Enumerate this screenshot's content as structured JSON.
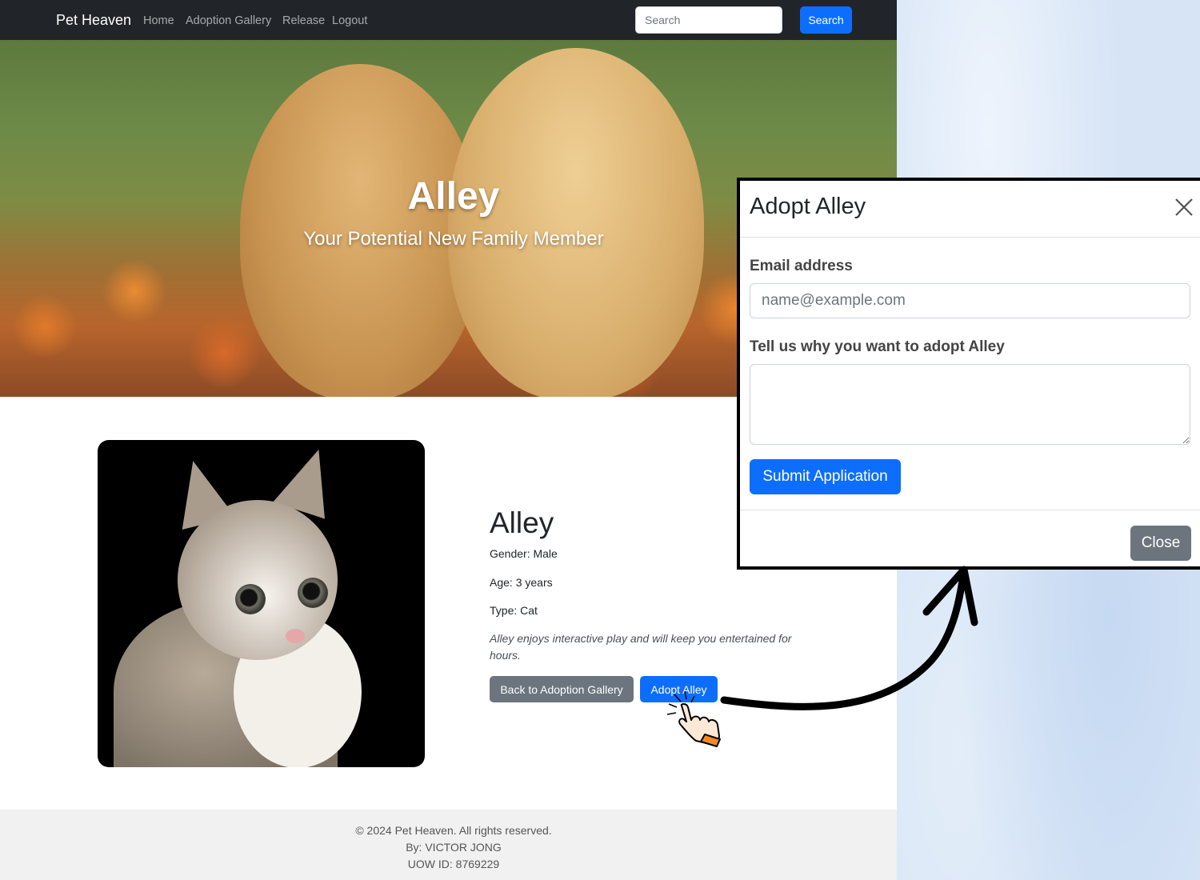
{
  "navbar": {
    "brand": "Pet Heaven",
    "links": [
      "Home",
      "Adoption Gallery",
      "Release",
      "Logout"
    ],
    "search_placeholder": "Search",
    "search_button": "Search"
  },
  "hero": {
    "title": "Alley",
    "subtitle": "Your Potential New Family Member"
  },
  "pet": {
    "name": "Alley",
    "gender": "Gender: Male",
    "age": "Age: 3 years",
    "type": "Type: Cat",
    "description": "Alley enjoys interactive play and will keep you entertained for hours.",
    "back_button": "Back to Adoption Gallery",
    "adopt_button": "Adopt Alley"
  },
  "footer": {
    "copyright": "© 2024 Pet Heaven. All rights reserved.",
    "author": "By: VICTOR JONG",
    "uow_id": "UOW ID: 8769229"
  },
  "modal": {
    "title": "Adopt Alley",
    "email_label": "Email address",
    "email_placeholder": "name@example.com",
    "reason_label": "Tell us why you want to adopt Alley",
    "submit_button": "Submit Application",
    "close_button": "Close"
  },
  "colors": {
    "navbar_bg": "#212529",
    "primary": "#0d6efd",
    "secondary": "#6c757d",
    "footer_bg": "#f1f1f1"
  },
  "icons": [
    "close-icon",
    "pointer-hand-icon",
    "curved-arrow-icon"
  ]
}
